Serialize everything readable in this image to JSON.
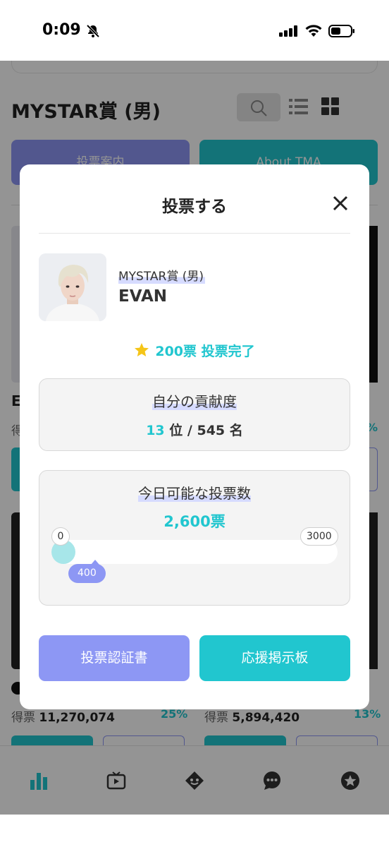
{
  "status_bar": {
    "time": "0:09",
    "icons": [
      "bell-slash-icon",
      "signal-icon",
      "wifi-icon",
      "battery-icon"
    ]
  },
  "background": {
    "title": "MYSTAR賞 (男)",
    "buttons": [
      "投票案内",
      "About TMA"
    ],
    "partial_name": "E",
    "vote_prefix": "得票",
    "right_percent_top": "3%",
    "entries": [
      {
        "prefix": "得票",
        "count": "11,270,074",
        "percent": "25%"
      },
      {
        "prefix": "得票",
        "count": "5,894,420",
        "percent": "13%"
      }
    ],
    "tab_icons": [
      "chart-icon",
      "tv-icon",
      "gift-icon",
      "chat-icon",
      "star-icon"
    ]
  },
  "modal": {
    "title": "投票する",
    "category": "MYSTAR賞 (男)",
    "name": "EVAN",
    "vote_complete": "200票 投票完了",
    "contribution": {
      "label": "自分の貢献度",
      "rank": "13",
      "rank_unit": "位",
      "separator": "/",
      "total": "545",
      "total_unit": "名"
    },
    "today": {
      "label": "今日可能な投票数",
      "value": "2,600票"
    },
    "slider": {
      "min": "0",
      "max": "3000",
      "value": "400",
      "fraction": 0.133
    },
    "buttons": {
      "certificate": "投票認証書",
      "board": "応援掲示板"
    }
  },
  "colors": {
    "accent_teal": "#21c6cf",
    "accent_purple": "#8d97f4",
    "star_yellow": "#f5c518"
  }
}
